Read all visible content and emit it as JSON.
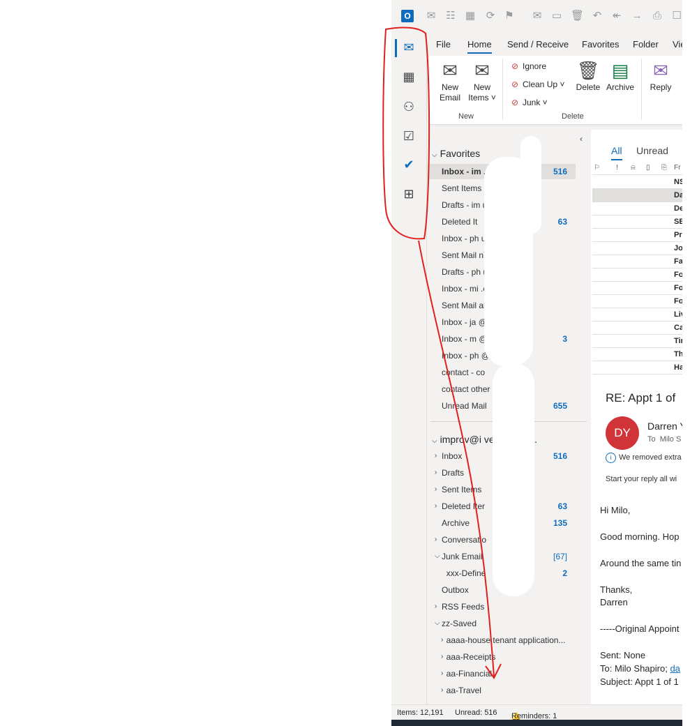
{
  "qat": {
    "icons": [
      "outlook-logo",
      "new-mail-icon",
      "contact-card-icon",
      "calendar-icon",
      "sync-icon",
      "flag-icon",
      "envelope-icon",
      "folder-icon",
      "trash-icon",
      "undo-icon",
      "reply-all-icon",
      "forward-icon",
      "print-icon",
      "checkbox-icon"
    ]
  },
  "appbar": {
    "items": [
      "mail-icon",
      "calendar-icon",
      "people-icon",
      "tasks-icon",
      "todo-icon",
      "apps-icon"
    ]
  },
  "ribbon": {
    "tabs": [
      "File",
      "Home",
      "Send / Receive",
      "Favorites",
      "Folder",
      "Vie"
    ],
    "active_tab": "Home",
    "new_email": "New\nEmail",
    "new_email_l1": "New",
    "new_email_l2": "Email",
    "new_items_l1": "New",
    "new_items_l2": "Items ˅",
    "ignore": "Ignore",
    "clean_up": "Clean Up ˅",
    "junk": "Junk ˅",
    "delete": "Delete",
    "archive": "Archive",
    "reply": "Reply",
    "group_new": "New",
    "group_delete": "Delete"
  },
  "folders": {
    "favorites_header": "Favorites",
    "favorites": [
      {
        "label": "Inbox - im                  ..",
        "count": "516"
      },
      {
        "label": "Sent Items",
        "count": ""
      },
      {
        "label": "Drafts - im               ures.c...",
        "count": ""
      },
      {
        "label": "Deleted It",
        "count": "63"
      },
      {
        "label": "Inbox - ph               urPh...",
        "count": ""
      },
      {
        "label": "Sent Mail              nYou...",
        "count": ""
      },
      {
        "label": "Drafts - ph              urPh...",
        "count": ""
      },
      {
        "label": "Inbox - mi                .com",
        "count": ""
      },
      {
        "label": "Sent Mail                ail.c...",
        "count": ""
      },
      {
        "label": "Inbox - ja              @g   .com",
        "count": ""
      },
      {
        "label": "Inbox - m               @gr      ",
        "count": "3"
      },
      {
        "label": "Inbox - ph              @g   .com",
        "count": ""
      },
      {
        "label": "contact - co",
        "count": ""
      },
      {
        "label": "contact other t    coaching",
        "count": ""
      },
      {
        "label": "Unread Mail",
        "count": "655"
      }
    ],
    "account_header": "improv@i      ventures.c...",
    "account": [
      {
        "label": "Inbox",
        "count": "516",
        "chev": ">"
      },
      {
        "label": "Drafts",
        "count": "",
        "chev": ">"
      },
      {
        "label": "Sent Items",
        "count": "",
        "chev": ">"
      },
      {
        "label": "Deleted Iter",
        "count": "63",
        "chev": ">"
      },
      {
        "label": "Archive",
        "count": "135",
        "chev": ""
      },
      {
        "label": "Conversatio         ry",
        "count": "",
        "chev": ">"
      },
      {
        "label": "Junk Email",
        "count": "[67]",
        "chev": "v"
      },
      {
        "label": "  xxx-Define        -xxx",
        "count": "2",
        "chev": ""
      },
      {
        "label": "Outbox",
        "count": "",
        "chev": ""
      },
      {
        "label": "RSS Feeds",
        "count": "",
        "chev": ">"
      },
      {
        "label": "zz-Saved",
        "count": "",
        "chev": "v"
      },
      {
        "label": "  aaaa-house tenant application...",
        "count": "",
        "chev": ">"
      },
      {
        "label": "  aaa-Receipts",
        "count": "",
        "chev": ">"
      },
      {
        "label": "  aa-Financial",
        "count": "",
        "chev": ">"
      },
      {
        "label": "  aa-Travel",
        "count": "",
        "chev": ">"
      }
    ]
  },
  "msglist": {
    "tab_all": "All",
    "tab_unread": "Unread",
    "col_from": "Fr",
    "rows": [
      "NS",
      "Da",
      "De",
      "SB",
      "Pr",
      "Jo",
      "Fa",
      "Fo",
      "Fo",
      "Fo",
      "Liv",
      "Ca",
      "Tir",
      "Th",
      "Ha"
    ]
  },
  "reading": {
    "subject": "RE: Appt 1 of",
    "avatar": "DY",
    "sender": "Darren Y",
    "to_label": "To",
    "to_name": "Milo S",
    "info": "We removed extra",
    "reply_hint": "Start your reply all wi",
    "body": [
      "Hi Milo,",
      "Good morning. Hop",
      "Around the same tin",
      "Thanks,",
      "Darren",
      "-----Original Appoint",
      "Sent: None"
    ],
    "to_line_prefix": "To: Milo Shapiro; ",
    "to_line_link": "da",
    "subject_line": "Subject: Appt 1 of 1"
  },
  "status": {
    "items": "Items: 12,191",
    "unread": "Unread: 516",
    "reminders": "Reminders: 1"
  },
  "colors": {
    "accent": "#0f6cbd",
    "annotation": "#e0201f",
    "avatar": "#d13438"
  }
}
